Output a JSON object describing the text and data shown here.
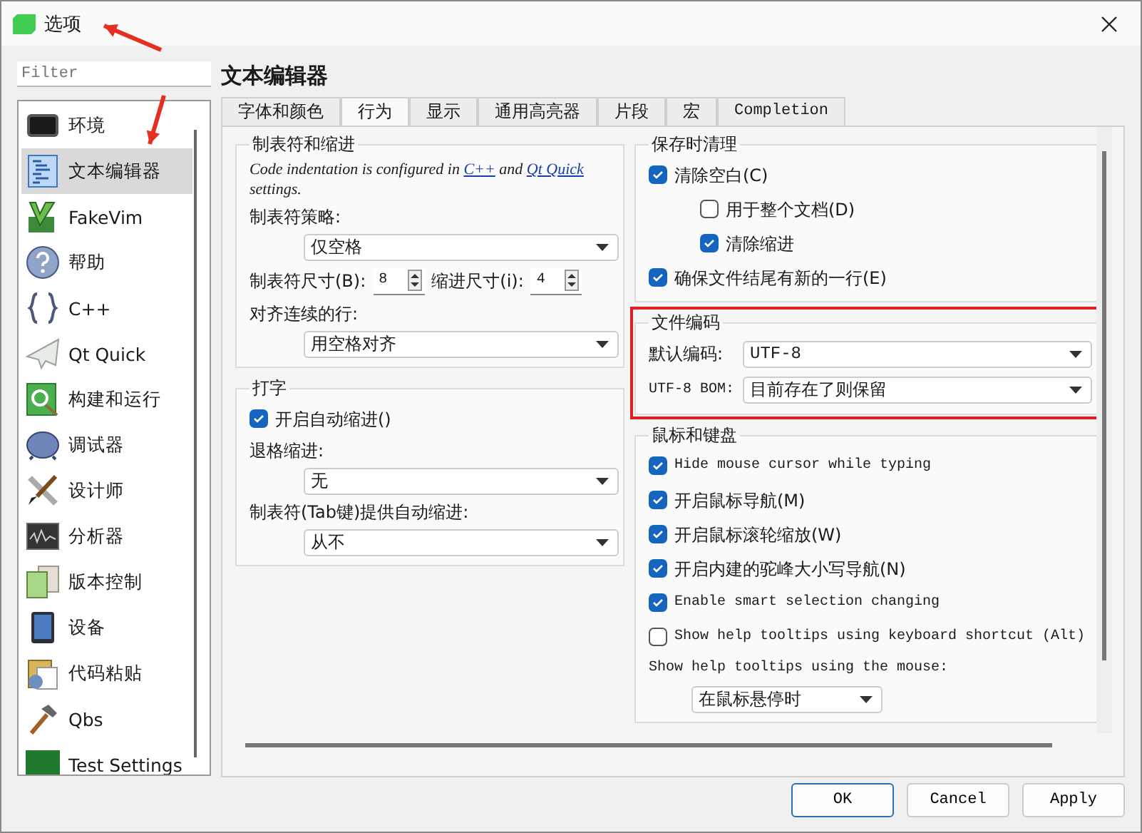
{
  "window": {
    "title": "选项"
  },
  "filter": {
    "placeholder": "Filter"
  },
  "sidebar": {
    "items": [
      {
        "label": "环境",
        "selected": false
      },
      {
        "label": "文本编辑器",
        "selected": true
      },
      {
        "label": "FakeVim",
        "selected": false
      },
      {
        "label": "帮助",
        "selected": false
      },
      {
        "label": "C++",
        "selected": false
      },
      {
        "label": "Qt Quick",
        "selected": false
      },
      {
        "label": "构建和运行",
        "selected": false
      },
      {
        "label": "调试器",
        "selected": false
      },
      {
        "label": "设计师",
        "selected": false
      },
      {
        "label": "分析器",
        "selected": false
      },
      {
        "label": "版本控制",
        "selected": false
      },
      {
        "label": "设备",
        "selected": false
      },
      {
        "label": "代码粘贴",
        "selected": false
      },
      {
        "label": "Qbs",
        "selected": false
      },
      {
        "label": "Test Settings",
        "selected": false
      }
    ]
  },
  "page_title": "文本编辑器",
  "tabs": [
    {
      "label": "字体和颜色",
      "selected": false
    },
    {
      "label": "行为",
      "selected": true
    },
    {
      "label": "显示",
      "selected": false
    },
    {
      "label": "通用高亮器",
      "selected": false
    },
    {
      "label": "片段",
      "selected": false
    },
    {
      "label": "宏",
      "selected": false
    },
    {
      "label": "Completion",
      "selected": false
    }
  ],
  "left_groups": [
    {
      "title": "制表符和缩进",
      "highlighted": false,
      "rows": [
        {
          "kind": "note",
          "parts": [
            {
              "text": "Code indentation is configured in ",
              "link": false
            },
            {
              "text": "C++",
              "link": true
            },
            {
              "text": " and ",
              "link": false
            },
            {
              "text": "Qt Quick",
              "link": true
            },
            {
              "text": " settings.",
              "link": false
            }
          ]
        },
        {
          "kind": "label",
          "text": "制表符策略:"
        },
        {
          "kind": "combo",
          "value": "仅空格"
        },
        {
          "kind": "spinners",
          "items": [
            {
              "label": "制表符尺寸(B):",
              "value": "8"
            },
            {
              "label": "缩进尺寸(i):",
              "value": "4"
            }
          ]
        },
        {
          "kind": "label",
          "text": "对齐连续的行:"
        },
        {
          "kind": "combo",
          "value": "用空格对齐"
        }
      ]
    },
    {
      "title": "打字",
      "highlighted": false,
      "rows": [
        {
          "kind": "checkbox",
          "text": "开启自动缩进()",
          "checked": true
        },
        {
          "kind": "label",
          "text": "退格缩进:"
        },
        {
          "kind": "combo",
          "value": "无"
        },
        {
          "kind": "label",
          "text": "制表符(Tab键)提供自动缩进:"
        },
        {
          "kind": "combo",
          "value": "从不"
        }
      ]
    }
  ],
  "right_groups": [
    {
      "title": "保存时清理",
      "highlighted": false,
      "rows": [
        {
          "kind": "checkbox",
          "text": "清除空白(C)",
          "checked": true,
          "children": [
            {
              "kind": "checkbox",
              "text": "用于整个文档(D)",
              "checked": false
            },
            {
              "kind": "checkbox",
              "text": "清除缩进",
              "checked": true
            }
          ]
        },
        {
          "kind": "checkbox",
          "text": "确保文件结尾有新的一行(E)",
          "checked": true
        }
      ]
    },
    {
      "title": "文件编码",
      "highlighted": true,
      "rows": [
        {
          "kind": "labeled_combo",
          "label": "默认编码:",
          "value": "UTF-8"
        },
        {
          "kind": "labeled_combo",
          "label": "UTF-8 BOM:",
          "value": "目前存在了则保留"
        }
      ]
    },
    {
      "title": "鼠标和键盘",
      "highlighted": false,
      "rows": [
        {
          "kind": "checkbox",
          "text": "Hide mouse cursor while typing",
          "checked": true
        },
        {
          "kind": "checkbox",
          "text": "开启鼠标导航(M)",
          "checked": true
        },
        {
          "kind": "checkbox",
          "text": "开启鼠标滚轮缩放(W)",
          "checked": true
        },
        {
          "kind": "checkbox",
          "text": "开启内建的驼峰大小写导航(N)",
          "checked": true
        },
        {
          "kind": "checkbox",
          "text": "Enable smart selection changing",
          "checked": true
        },
        {
          "kind": "checkbox",
          "text": "Show help tooltips using keyboard shortcut (Alt)",
          "checked": false
        },
        {
          "kind": "label",
          "text": "Show help tooltips using the mouse:"
        },
        {
          "kind": "short_combo",
          "value": "在鼠标悬停时"
        }
      ]
    }
  ],
  "buttons": [
    {
      "label": "OK",
      "focused": true
    },
    {
      "label": "Cancel",
      "focused": false
    },
    {
      "label": "Apply",
      "focused": false
    }
  ],
  "annotations": [
    {
      "kind": "arrow"
    },
    {
      "kind": "arrow"
    }
  ]
}
